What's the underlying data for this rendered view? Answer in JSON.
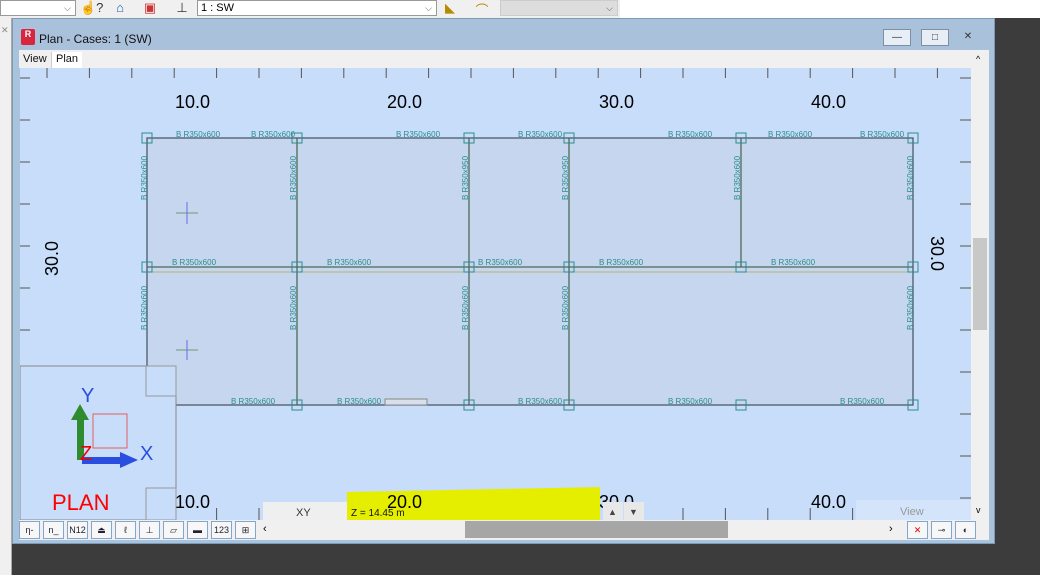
{
  "toolbar": {
    "case_select": "1 : SW"
  },
  "window": {
    "title": "Plan - Cases: 1 (SW)",
    "minimize": "—",
    "maximize": "□",
    "close": "✕"
  },
  "tabs": [
    {
      "label": "View"
    },
    {
      "label": "Plan"
    }
  ],
  "axis": {
    "top": [
      "10.0",
      "20.0",
      "30.0",
      "40.0"
    ],
    "bottom": [
      "10.0",
      "20.0",
      "30.0",
      "40.0"
    ],
    "left": "30.0",
    "right": "30.0"
  },
  "beams": {
    "top": [
      "B R350x600",
      "B R350x600",
      "B R350x600",
      "B R350x600",
      "B R350x600",
      "B R350x600",
      "B R350x600"
    ],
    "middle": [
      "B R350x600",
      "B R350x600",
      "B R350x600",
      "B R350x600",
      "B R350x600"
    ],
    "bottom": [
      "B R350x600",
      "B R350x600",
      "B R350x600",
      "B R350x600",
      "B R350x600"
    ],
    "upper_cols": [
      "B R350x600",
      "B R350x600",
      "B R350x950",
      "B R350x950",
      "B R350x600",
      "B R350x600"
    ],
    "lower_cols": [
      "B R350x600",
      "B R350x600",
      "B R350x600",
      "B R350x600",
      "B R350x600"
    ]
  },
  "axes_gizmo": {
    "y": "Y",
    "z": "Z",
    "x": "X",
    "view_name": "PLAN"
  },
  "status": {
    "plane": "XY",
    "z_level": "Z = 14.45 m",
    "view_label": "View"
  },
  "colors": {
    "canvas": "#c8ddfa",
    "beam_label": "#2a8d8d",
    "highlight": "#e6ee00",
    "plan_label": "#ff0000"
  }
}
